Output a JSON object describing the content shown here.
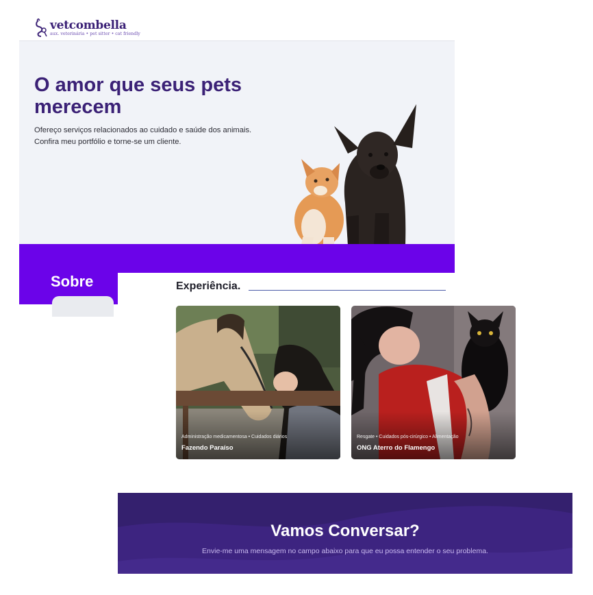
{
  "brand": {
    "name": "vetcombella",
    "tagline": "aux. veterinária • pet sitter • cat friendly"
  },
  "hero": {
    "title": "O amor que seus pets merecem",
    "text": "Ofereço serviços relacionados ao cuidado e saúde dos animais. Confira meu portfólio e torne-se um cliente."
  },
  "about": {
    "heading": "Sobre"
  },
  "experience": {
    "heading": "Experiência.",
    "cards": [
      {
        "tags": "Administração medicamentosa • Cuidados diários",
        "name": "Fazendo Paraíso"
      },
      {
        "tags": "Resgate • Cuidados pós-cirúrgico • Alimentação",
        "name": "ONG Aterro do Flamengo"
      }
    ]
  },
  "contact": {
    "heading": "Vamos Conversar?",
    "text": "Envie-me uma mensagem no campo abaixo para que eu possa entender o seu problema."
  },
  "colors": {
    "brand_purple": "#3b2176",
    "accent_violet": "#6b03e9",
    "contact_bg": "#3d2480"
  }
}
